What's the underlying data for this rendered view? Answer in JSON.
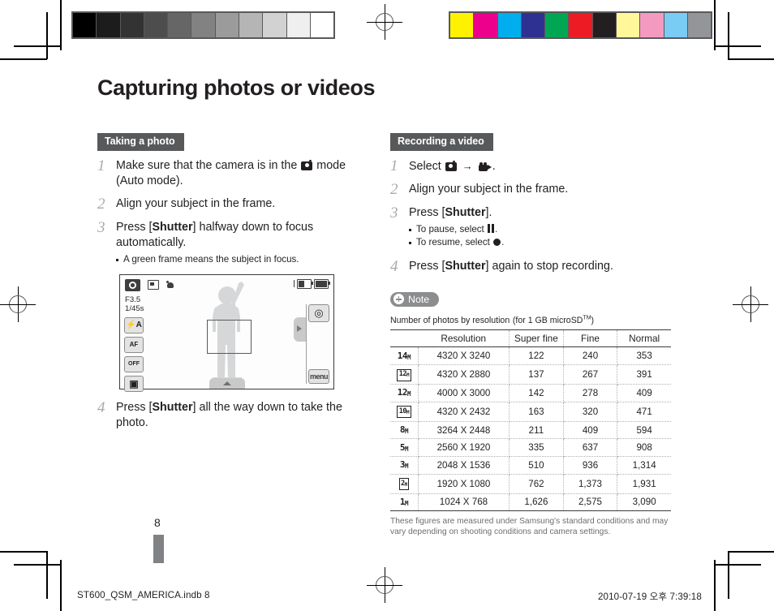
{
  "page": {
    "title": "Capturing photos or videos",
    "page_number": "8",
    "footer_left": "ST600_QSM_AMERICA.indb   8",
    "footer_right": "2010-07-19   오후 7:39:18"
  },
  "gray_bar": {
    "name": "grayscale-calibration-bar",
    "swatches": [
      "#000000",
      "#1c1c1c",
      "#333333",
      "#4d4d4d",
      "#666666",
      "#828282",
      "#9b9b9b",
      "#b5b5b5",
      "#d2d2d2",
      "#efefef",
      "#ffffff"
    ]
  },
  "color_bar": {
    "name": "cmyk-calibration-bar",
    "swatches": [
      "#fff200",
      "#ec008c",
      "#00aeef",
      "#2e3192",
      "#00a651",
      "#ed1c24",
      "#231f20",
      "#fff79a",
      "#f49ac1",
      "#7accf4",
      "#939598"
    ]
  },
  "left_column": {
    "section_title": "Taking a photo",
    "steps": [
      {
        "number": "1",
        "parts": [
          {
            "type": "text",
            "value": "Make sure that the camera is in the "
          },
          {
            "type": "icon",
            "value": "camera-mode-icon"
          },
          {
            "type": "text",
            "value": " mode (Auto mode)."
          }
        ],
        "plain": "Make sure that the camera is in the  mode (Auto mode)."
      },
      {
        "number": "2",
        "plain": "Align your subject in the frame."
      },
      {
        "number": "3",
        "plain": "Press [Shutter] halfway down to focus automatically.",
        "bold_token": "Shutter",
        "sub_items": [
          "A green frame means the subject in focus."
        ]
      },
      {
        "number": "4",
        "plain": "Press [Shutter] all the way down to take the photo.",
        "bold_token": "Shutter"
      }
    ],
    "step_text": {
      "s1_pre": "Make sure that the camera is in the",
      "s1_post": "mode (Auto mode).",
      "s2": "Align your subject in the frame.",
      "s3_pre": "Press [",
      "s3_bold": "Shutter",
      "s3_post": "] halfway down to focus automatically.",
      "s3_sub1": "A green frame means the subject in focus.",
      "s4_pre": "Press [",
      "s4_bold": "Shutter",
      "s4_post": "] all the way down to take the photo."
    },
    "camera_screen": {
      "name": "camera-lcd-preview",
      "mode_icon": "camera-mode-icon",
      "top_icons": [
        "image-quality-icon",
        "scene-mode-icon"
      ],
      "aperture": "F3.5",
      "shutter_speed": "1/45s",
      "left_buttons": [
        {
          "name": "flash-auto-button",
          "label": "⚡A"
        },
        {
          "name": "autofocus-button",
          "label": "AF"
        },
        {
          "name": "timer-off-button",
          "label": "OFF"
        },
        {
          "name": "image-size-button",
          "label": "▣"
        }
      ],
      "right_buttons": [
        {
          "name": "smart-auto-button",
          "label": "◎"
        },
        {
          "name": "menu-button",
          "label": "menu"
        }
      ],
      "battery_icons": [
        "memory-card-icon",
        "battery-full-icon"
      ]
    }
  },
  "right_column": {
    "section_title": "Recording a video",
    "step_text": {
      "s1_pre": "Select",
      "s1_mid": "→",
      "s1_post": ".",
      "s2": "Align your subject in the frame.",
      "s3_pre": "Press [",
      "s3_bold": "Shutter",
      "s3_post": "].",
      "s3_sub1_pre": "To pause, select",
      "s3_sub1_post": ".",
      "s3_sub2_pre": "To resume, select",
      "s3_sub2_post": ".",
      "s4_pre": "Press [",
      "s4_bold": "Shutter",
      "s4_post": "] again to stop recording."
    },
    "step_numbers": [
      "1",
      "2",
      "3",
      "4"
    ],
    "note_badge": "Note",
    "table_title": "Number of photos by resolution",
    "table_title_suffix": "(for 1 GB microSD",
    "table_title_tm": "TM",
    "table_title_suffix_end": ")",
    "table": {
      "headers": [
        "Resolution",
        "Super fine",
        "Fine",
        "Normal"
      ],
      "rows": [
        {
          "icon": "14",
          "icon_boxed": false,
          "resolution": "4320 X 3240",
          "super_fine": "122",
          "fine": "240",
          "normal": "353"
        },
        {
          "icon": "12",
          "icon_boxed": true,
          "resolution": "4320 X 2880",
          "super_fine": "137",
          "fine": "267",
          "normal": "391"
        },
        {
          "icon": "12",
          "icon_boxed": false,
          "resolution": "4000 X 3000",
          "super_fine": "142",
          "fine": "278",
          "normal": "409"
        },
        {
          "icon": "10",
          "icon_boxed": true,
          "resolution": "4320 X 2432",
          "super_fine": "163",
          "fine": "320",
          "normal": "471"
        },
        {
          "icon": "8",
          "icon_boxed": false,
          "resolution": "3264 X 2448",
          "super_fine": "211",
          "fine": "409",
          "normal": "594"
        },
        {
          "icon": "5",
          "icon_boxed": false,
          "resolution": "2560 X 1920",
          "super_fine": "335",
          "fine": "637",
          "normal": "908"
        },
        {
          "icon": "3",
          "icon_boxed": false,
          "resolution": "2048 X 1536",
          "super_fine": "510",
          "fine": "936",
          "normal": "1,314"
        },
        {
          "icon": "2",
          "icon_boxed": true,
          "resolution": "1920 X 1080",
          "super_fine": "762",
          "fine": "1,373",
          "normal": "1,931"
        },
        {
          "icon": "1",
          "icon_boxed": false,
          "resolution": "1024 X 768",
          "super_fine": "1,626",
          "fine": "2,575",
          "normal": "3,090"
        }
      ]
    },
    "table_footnote": "These figures are measured under Samsung's standard conditions and may vary depending on shooting conditions and camera settings."
  }
}
